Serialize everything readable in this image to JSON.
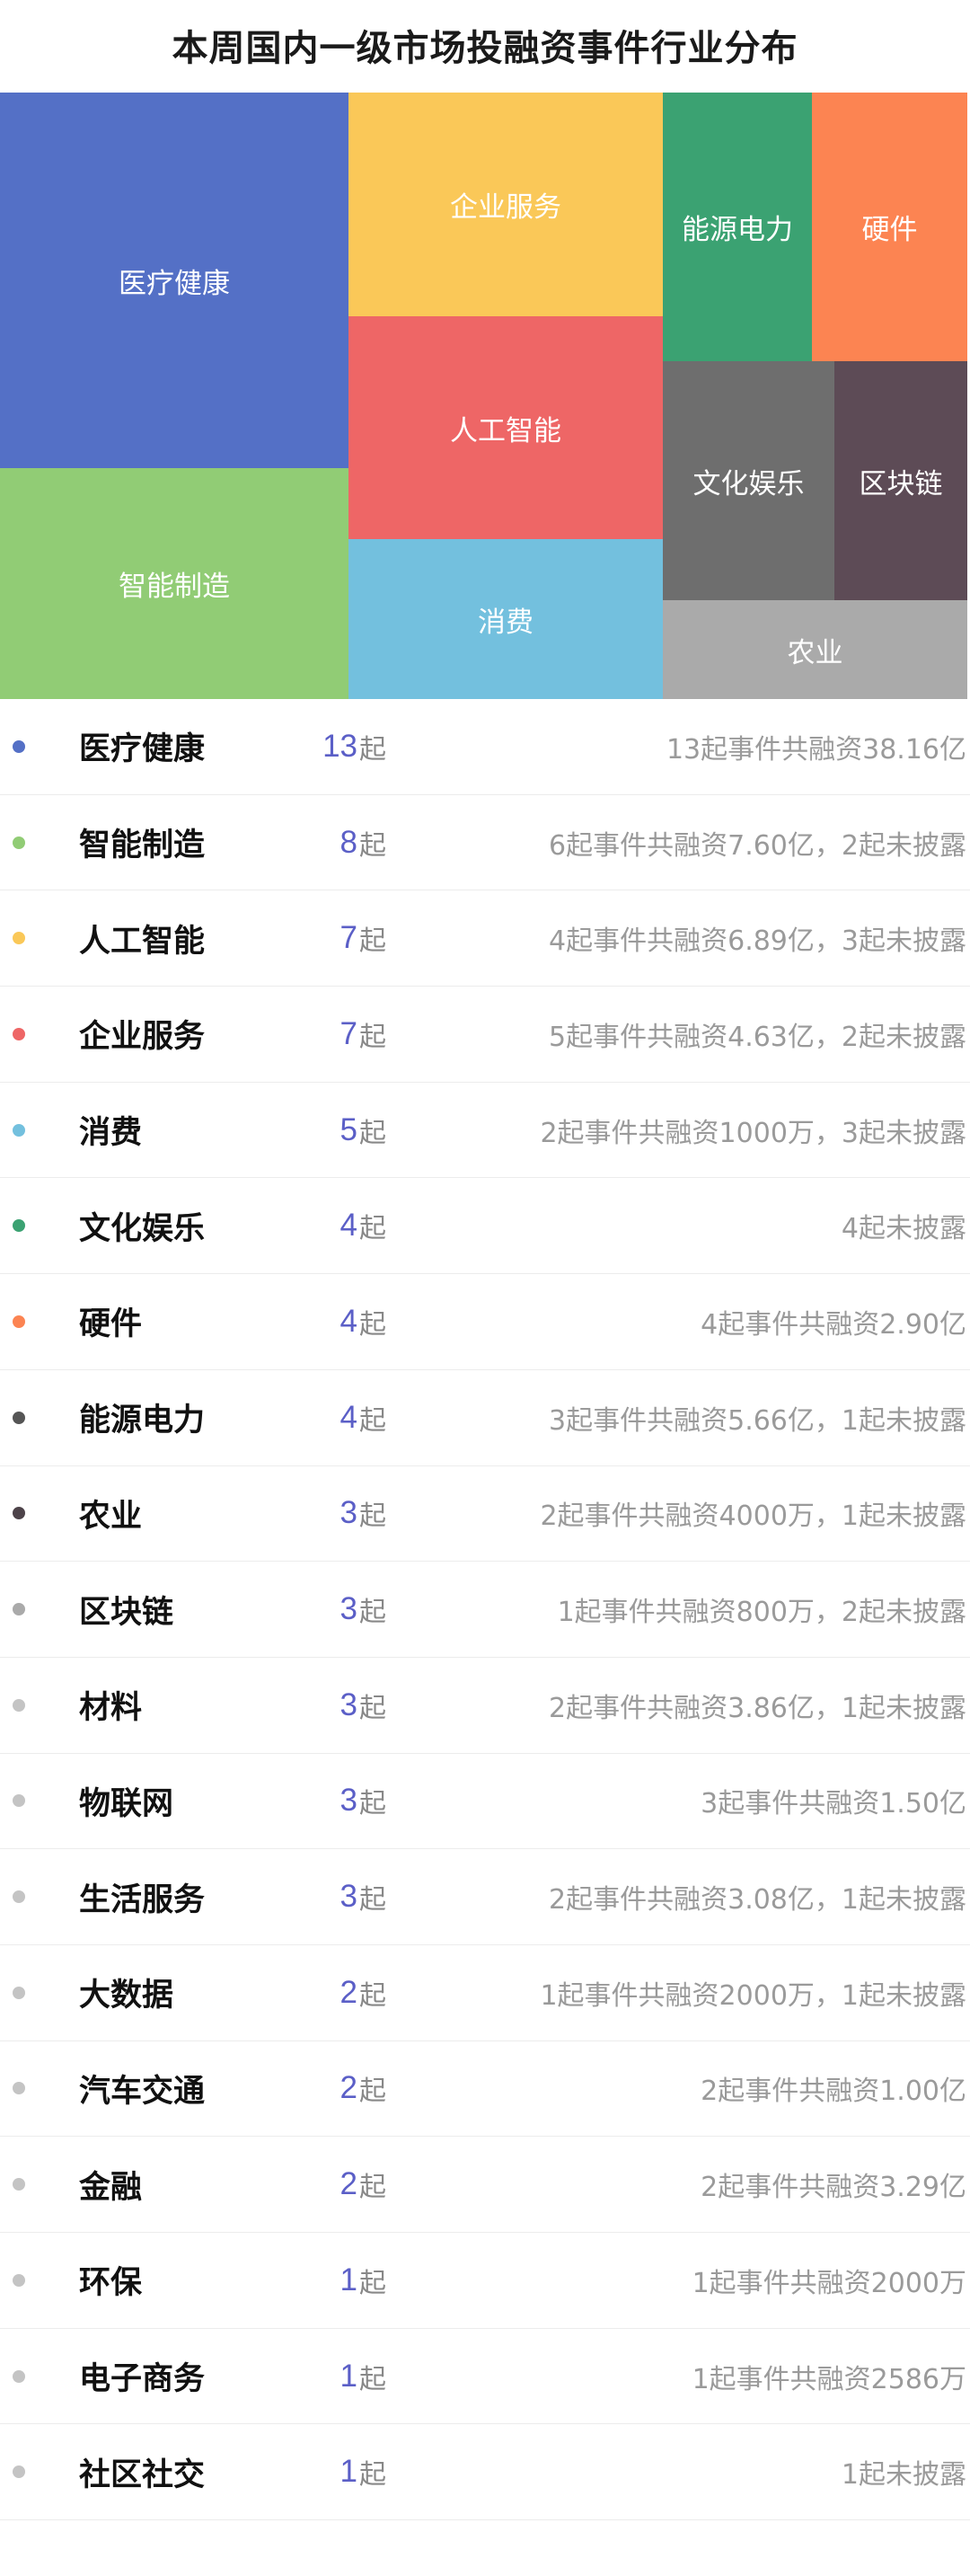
{
  "title": "本周国内一级市场投融资事件行业分布",
  "unit": "起",
  "chart_data": {
    "type": "treemap",
    "title": "本周国内一级市场投融资事件行业分布",
    "items": [
      {
        "name": "医疗健康",
        "value": 13,
        "color": "#5470c6"
      },
      {
        "name": "智能制造",
        "value": 8,
        "color": "#91cc75"
      },
      {
        "name": "企业服务",
        "value": 7,
        "color": "#fac858"
      },
      {
        "name": "人工智能",
        "value": 7,
        "color": "#ee6666"
      },
      {
        "name": "消费",
        "value": 5,
        "color": "#73c0de"
      },
      {
        "name": "能源电力",
        "value": 4,
        "color": "#3ba272"
      },
      {
        "name": "硬件",
        "value": 4,
        "color": "#fc8452"
      },
      {
        "name": "文化娱乐",
        "value": 4,
        "color": "#6e6e6e"
      },
      {
        "name": "区块链",
        "value": 3,
        "color": "#5d4b56"
      },
      {
        "name": "农业",
        "value": 3,
        "color": "#aaaaaa"
      }
    ]
  },
  "list": [
    {
      "name": "医疗健康",
      "count": "13",
      "detail": "13起事件共融资38.16亿",
      "dot": "#5470c6"
    },
    {
      "name": "智能制造",
      "count": "8",
      "detail": "6起事件共融资7.60亿，2起未披露",
      "dot": "#91cc75"
    },
    {
      "name": "人工智能",
      "count": "7",
      "detail": "4起事件共融资6.89亿，3起未披露",
      "dot": "#fac858"
    },
    {
      "name": "企业服务",
      "count": "7",
      "detail": "5起事件共融资4.63亿，2起未披露",
      "dot": "#ee6666"
    },
    {
      "name": "消费",
      "count": "5",
      "detail": "2起事件共融资1000万，3起未披露",
      "dot": "#73c0de"
    },
    {
      "name": "文化娱乐",
      "count": "4",
      "detail": "4起未披露",
      "dot": "#3ba272"
    },
    {
      "name": "硬件",
      "count": "4",
      "detail": "4起事件共融资2.90亿",
      "dot": "#fc8452"
    },
    {
      "name": "能源电力",
      "count": "4",
      "detail": "3起事件共融资5.66亿，1起未披露",
      "dot": "#555555"
    },
    {
      "name": "农业",
      "count": "3",
      "detail": "2起事件共融资4000万，1起未披露",
      "dot": "#4d4349"
    },
    {
      "name": "区块链",
      "count": "3",
      "detail": "1起事件共融资800万，2起未披露",
      "dot": "#aaaaaa"
    },
    {
      "name": "材料",
      "count": "3",
      "detail": "2起事件共融资3.86亿，1起未披露",
      "dot": "#c4c4c4"
    },
    {
      "name": "物联网",
      "count": "3",
      "detail": "3起事件共融资1.50亿",
      "dot": "#c4c4c4"
    },
    {
      "name": "生活服务",
      "count": "3",
      "detail": "2起事件共融资3.08亿，1起未披露",
      "dot": "#c4c4c4"
    },
    {
      "name": "大数据",
      "count": "2",
      "detail": "1起事件共融资2000万，1起未披露",
      "dot": "#c4c4c4"
    },
    {
      "name": "汽车交通",
      "count": "2",
      "detail": "2起事件共融资1.00亿",
      "dot": "#c4c4c4"
    },
    {
      "name": "金融",
      "count": "2",
      "detail": "2起事件共融资3.29亿",
      "dot": "#c4c4c4"
    },
    {
      "name": "环保",
      "count": "1",
      "detail": "1起事件共融资2000万",
      "dot": "#c4c4c4"
    },
    {
      "name": "电子商务",
      "count": "1",
      "detail": "1起事件共融资2586万",
      "dot": "#c4c4c4"
    },
    {
      "name": "社区社交",
      "count": "1",
      "detail": "1起未披露",
      "dot": "#c4c4c4"
    }
  ]
}
